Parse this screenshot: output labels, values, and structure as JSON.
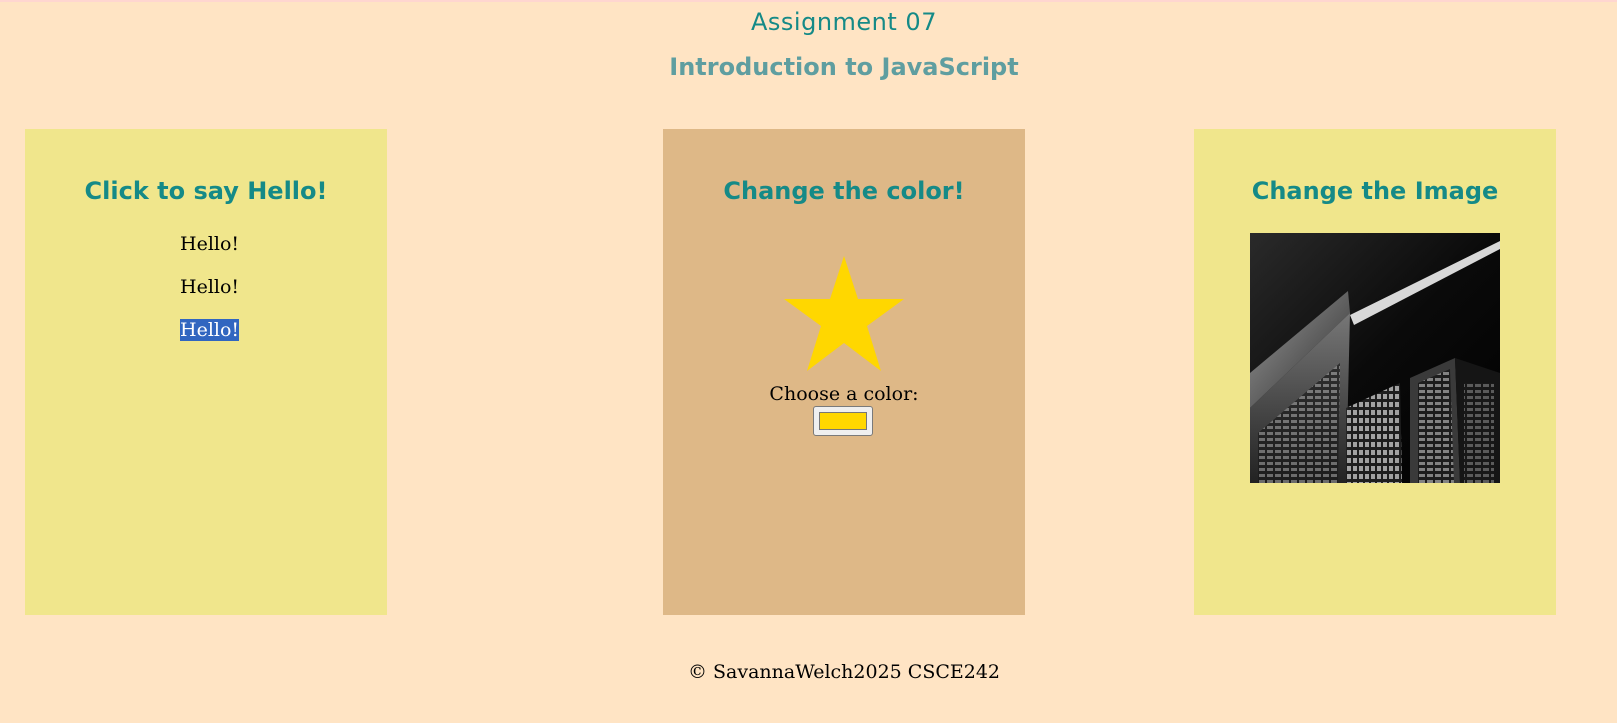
{
  "header": {
    "title": "Assignment 07",
    "subtitle": "Introduction to JavaScript"
  },
  "hello_panel": {
    "title": "Click to say Hello!",
    "items": [
      "Hello!",
      "Hello!",
      "Hello!"
    ]
  },
  "color_panel": {
    "title": "Change the color!",
    "label": "Choose a color:",
    "star_color": "#ffd700",
    "input_value": "#ffd700"
  },
  "image_panel": {
    "title": "Change the Image"
  },
  "footer": {
    "text": "© SavannaWelch2025 CSCE242"
  },
  "colors": {
    "background": "#ffe4c4",
    "panel_yellow": "#f0e68c",
    "panel_tan": "#deb887",
    "title_teal": "#158a87",
    "subtitle_teal": "#5f9ea0",
    "selection": "#3166c0"
  }
}
